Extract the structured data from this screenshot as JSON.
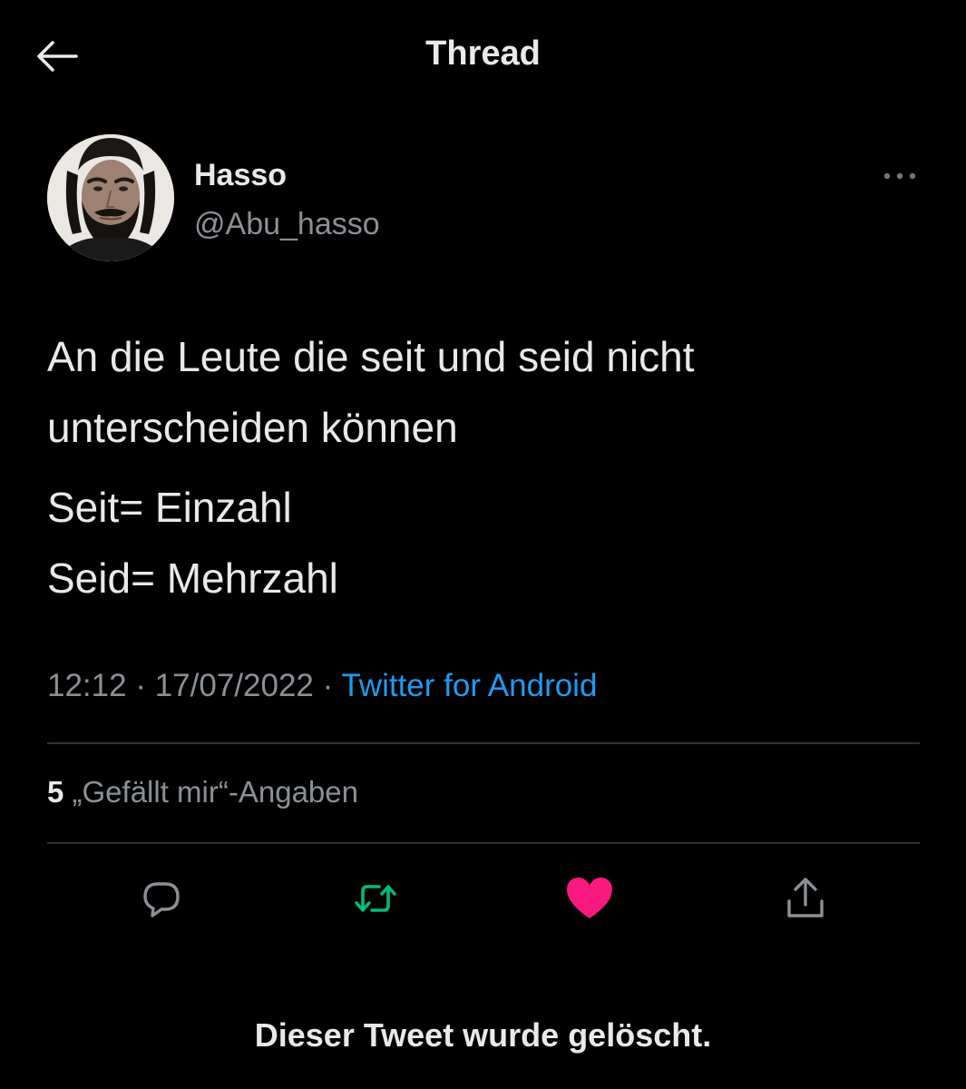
{
  "header": {
    "title": "Thread",
    "back_icon": "arrow-left-icon"
  },
  "tweet": {
    "author": {
      "name": "Hasso",
      "handle": "@Abu_hasso"
    },
    "more_icon": "ellipsis-icon",
    "text_lines": [
      "An die Leute die seit und seid nicht",
      "unterscheiden können",
      "Seit= Einzahl",
      "Seid= Mehrzahl"
    ],
    "meta": {
      "time": "12:12",
      "separator": " · ",
      "date": "17/07/2022",
      "source": "Twitter for Android"
    },
    "likes": {
      "count": "5",
      "label": " „Gefällt mir“-Angaben"
    },
    "actions": [
      {
        "name": "reply",
        "icon": "speech-bubble-icon",
        "color": "#8b9096"
      },
      {
        "name": "retweet",
        "icon": "retweet-icon",
        "color": "#00ba7c"
      },
      {
        "name": "like",
        "icon": "heart-icon",
        "color": "#f91880",
        "active": true
      },
      {
        "name": "share",
        "icon": "share-icon",
        "color": "#8b9096"
      }
    ]
  },
  "footer": {
    "deleted_notice": "Dieser Tweet wurde gelöscht."
  },
  "colors": {
    "background": "#000000",
    "text": "#e7e9ea",
    "secondary_text": "#8b9096",
    "link": "#1d9bf0",
    "divider": "#2f3336",
    "retweet": "#00ba7c",
    "like": "#f91880"
  }
}
